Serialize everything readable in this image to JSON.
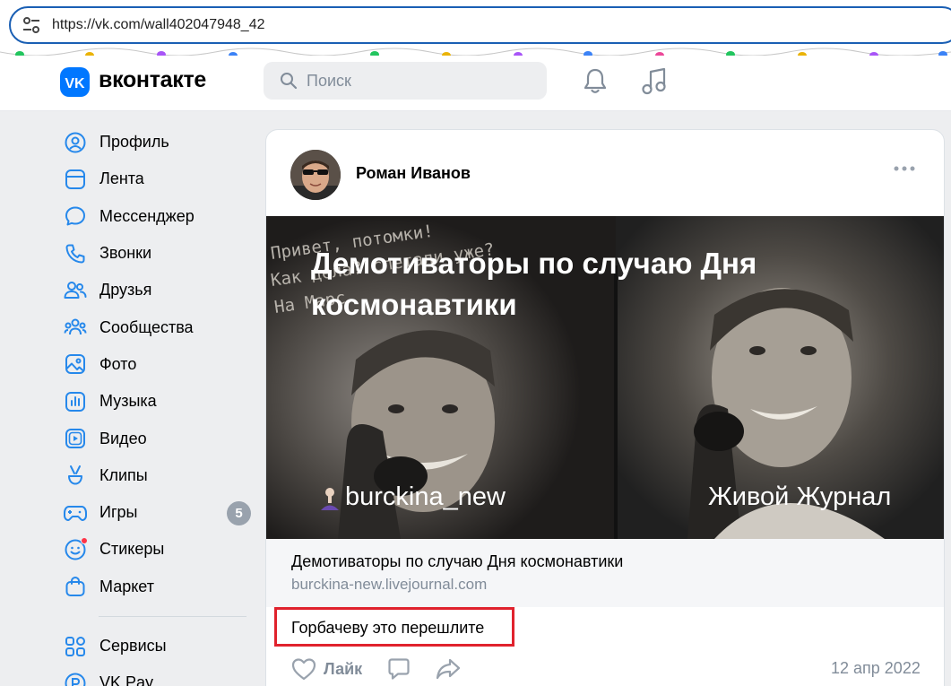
{
  "browser": {
    "url": "https://vk.com/wall402047948_42"
  },
  "header": {
    "logo_text": "вконтакте",
    "search_placeholder": "Поиск",
    "accent": "#0077ff"
  },
  "sidebar": {
    "items": [
      {
        "label": "Профиль",
        "icon": "user-circle-icon"
      },
      {
        "label": "Лента",
        "icon": "feed-icon"
      },
      {
        "label": "Мессенджер",
        "icon": "chat-bubble-icon"
      },
      {
        "label": "Звонки",
        "icon": "phone-icon"
      },
      {
        "label": "Друзья",
        "icon": "friends-icon"
      },
      {
        "label": "Сообщества",
        "icon": "communities-icon"
      },
      {
        "label": "Фото",
        "icon": "photo-icon"
      },
      {
        "label": "Музыка",
        "icon": "music-square-icon"
      },
      {
        "label": "Видео",
        "icon": "video-icon"
      },
      {
        "label": "Клипы",
        "icon": "clips-icon"
      },
      {
        "label": "Игры",
        "icon": "gamepad-icon",
        "badge": "5"
      },
      {
        "label": "Стикеры",
        "icon": "sticker-icon"
      },
      {
        "label": "Маркет",
        "icon": "market-bag-icon"
      }
    ],
    "items_after_divider": [
      {
        "label": "Сервисы",
        "icon": "services-grid-icon"
      },
      {
        "label": "VK Pay",
        "icon": "vkpay-icon"
      }
    ]
  },
  "post": {
    "author": "Роман Иванов",
    "image_title": "Демотиваторы по случаю Дня космонавтики",
    "image_handwriting": "Привет, потомки! Как дела? На Марс слетали уже?",
    "image_signature_left": "burckina_new",
    "image_signature_right": "Живой Журнал",
    "link_title": "Демотиваторы по случаю Дня космонавтики",
    "link_url": "burckina-new.livejournal.com",
    "text": "Горбачеву это перешлите",
    "like_label": "Лайк",
    "date": "12 апр 2022"
  }
}
